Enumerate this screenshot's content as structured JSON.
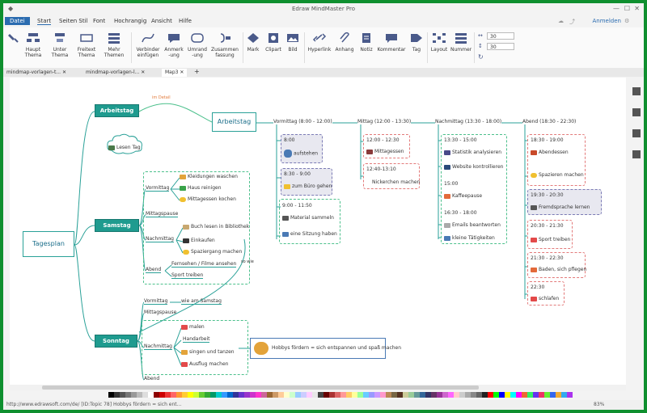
{
  "window": {
    "title": "Edraw MindMaster Pro"
  },
  "menu": {
    "file": "Datei",
    "tabs": [
      "Start",
      "Seiten Stil",
      "Font",
      "Hochrangig",
      "Ansicht",
      "Hilfe"
    ],
    "login": "Anmelden"
  },
  "ribbon": {
    "buttons": [
      "Haupt Thema",
      "Unter Thema",
      "Freitext Thema",
      "Mehr Themen",
      "Verbinder einfügen",
      "Anmerk -ung",
      "Umrand -ung",
      "Zusammen fassung",
      "Mark",
      "Clipart",
      "Bild",
      "Hyperlink",
      "Anhang",
      "Notiz",
      "Kommentar",
      "Tag",
      "Layout",
      "Nummer"
    ],
    "spin1": "30",
    "spin2": "30"
  },
  "doc_tabs": [
    "mindmap-vorlagen-t...",
    "mindmap-vorlagen-l...",
    "Map3"
  ],
  "map": {
    "center": "Tagesplan",
    "arbeitstag_top": "Arbeitstag",
    "im_detail": "im Detail",
    "arbeitstag_node": "Arbeitstag",
    "lesen_tag": "Lesen Tag",
    "samstag": "Samstag",
    "sonntag": "Sonntag",
    "sa_vormittag": "Vormittag",
    "sa_vormittag_items": [
      "Kleidungen waschen",
      "Haus reinigen",
      "Mittagessen kochen"
    ],
    "sa_mittagspause": "Mittagspause",
    "sa_nachmittag": "Nachmittag",
    "sa_nachmittag_items": [
      "Buch lesen in Bibliothek",
      "Einkaufen",
      "Spaziergang machen"
    ],
    "sa_abend": "Abend",
    "sa_abend_items": [
      "Fernsehen / Filme ansehen",
      "Sport treiben"
    ],
    "so_wie": "so wie",
    "so_vormittag": "Vormittag",
    "so_vormittag_item": "wie am Samstag",
    "so_mittagspause": "Mittagspause",
    "so_nachmittag": "Nachmittag",
    "so_nachmittag_items": [
      "malen",
      "Handarbeit",
      "singen und tanzen",
      "Ausflug machen"
    ],
    "so_abend": "Abend",
    "hobby_note": "Hobbys fördern = sich entspannen und spaß machen",
    "columns": [
      "Vormittag (8:00 - 12:00)",
      "Mittag (12:00 - 13:30)",
      "Nachmittag (13:30 - 18:00)",
      "Abend (18:30 - 22:30)"
    ],
    "vormittag_items": [
      {
        "time": "8:00",
        "text": "aufstehen"
      },
      {
        "time": "8:30 - 9:00",
        "text": "zum Büro gehen"
      },
      {
        "time": "9:00 - 11:50",
        "text": "Material sammeln"
      },
      {
        "time": "",
        "text": "eine Sitzung haben"
      }
    ],
    "mittag_items": [
      {
        "time": "12:00 - 12:30",
        "text": "Mittagessen"
      },
      {
        "time": "12:40-13:10",
        "text": "Nickerchen machen"
      }
    ],
    "nachmittag_items": [
      {
        "time": "13:30 - 15:00",
        "text": "Statistik analysieren"
      },
      {
        "time": "",
        "text": "Website kontrollieren"
      },
      {
        "time": "15:00",
        "text": "Kaffeepause"
      },
      {
        "time": "16:30 - 18:00",
        "text": "Emails beantworten"
      },
      {
        "time": "",
        "text": "kleine Tätigkeiten"
      }
    ],
    "abend_items": [
      {
        "time": "18:30 - 19:00",
        "text": "Abendessen"
      },
      {
        "time": "",
        "text": "Spazieren machen"
      },
      {
        "time": "19:30 - 20:30",
        "text": "Fremdsprache lernen"
      },
      {
        "time": "20:30 - 21:30",
        "text": "Sport treiben"
      },
      {
        "time": "21:30 - 22:30",
        "text": "Baden, sich pflegen"
      },
      {
        "time": "22:30",
        "text": "schlafen"
      }
    ]
  },
  "status": {
    "left": "http://www.edrawsoft.com/de/  [ID:Topic 78]  Hobbys fördern = sich ent...",
    "zoom": "83%"
  },
  "colors": {
    "accent": "#2b6cb0",
    "teal": "#1f9b8f",
    "frame": "#0f8f2f"
  }
}
